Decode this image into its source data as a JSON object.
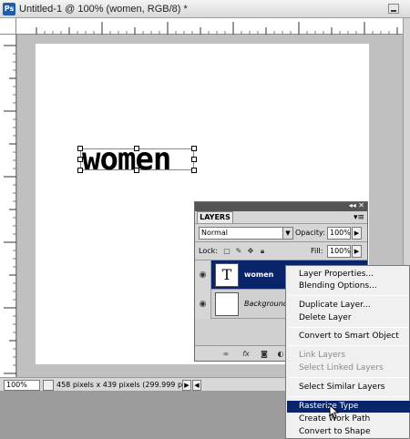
{
  "window": {
    "app_icon": "Ps",
    "title": "Untitled-1 @ 100% (women, RGB/8) *"
  },
  "canvas": {
    "text": "women"
  },
  "statusbar": {
    "zoom": "100%",
    "info": "458 pixels x 439 pixels (299.999 ppi)"
  },
  "layers_panel": {
    "tab_label": "LAYERS",
    "blend_mode": "Normal",
    "opacity_label": "Opacity:",
    "opacity_value": "100%",
    "lock_label": "Lock:",
    "fill_label": "Fill:",
    "fill_value": "100%",
    "layers": [
      {
        "name": "women",
        "thumb": "T",
        "selected": true
      },
      {
        "name": "Background",
        "thumb": "",
        "selected": false
      }
    ]
  },
  "context_menu": {
    "items": [
      {
        "label": "Layer Properties...",
        "disabled": false
      },
      {
        "label": "Blending Options...",
        "disabled": false
      },
      {
        "label": "Duplicate Layer...",
        "disabled": false
      },
      {
        "label": "Delete Layer",
        "disabled": false
      },
      {
        "label": "Convert to Smart Object",
        "disabled": false
      },
      {
        "label": "Link Layers",
        "disabled": true
      },
      {
        "label": "Select Linked Layers",
        "disabled": true
      },
      {
        "label": "Select Similar Layers",
        "disabled": false
      },
      {
        "label": "Rasterize Type",
        "disabled": false,
        "highlighted": true
      },
      {
        "label": "Create Work Path",
        "disabled": false
      },
      {
        "label": "Convert to Shape",
        "disabled": false
      }
    ]
  }
}
